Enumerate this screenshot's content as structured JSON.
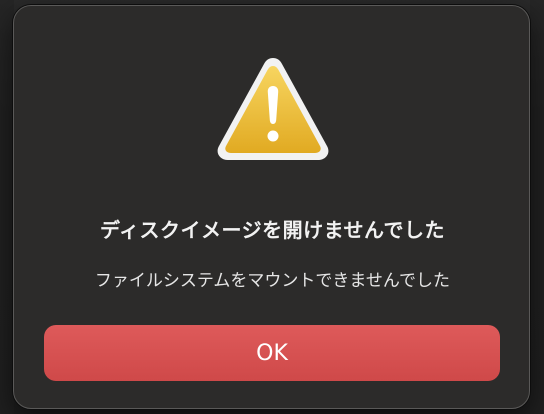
{
  "dialog": {
    "icon": "warning-triangle-icon",
    "title": "ディスクイメージを開けませんでした",
    "message": "ファイルシステムをマウントできませんでした",
    "ok_label": "OK"
  },
  "colors": {
    "dialog_background": "#2c2b2a",
    "dialog_border": "#5a5958",
    "button_red": "#d84f4f",
    "warning_yellow": "#f0c43a",
    "text_primary": "#f2f2f2"
  }
}
